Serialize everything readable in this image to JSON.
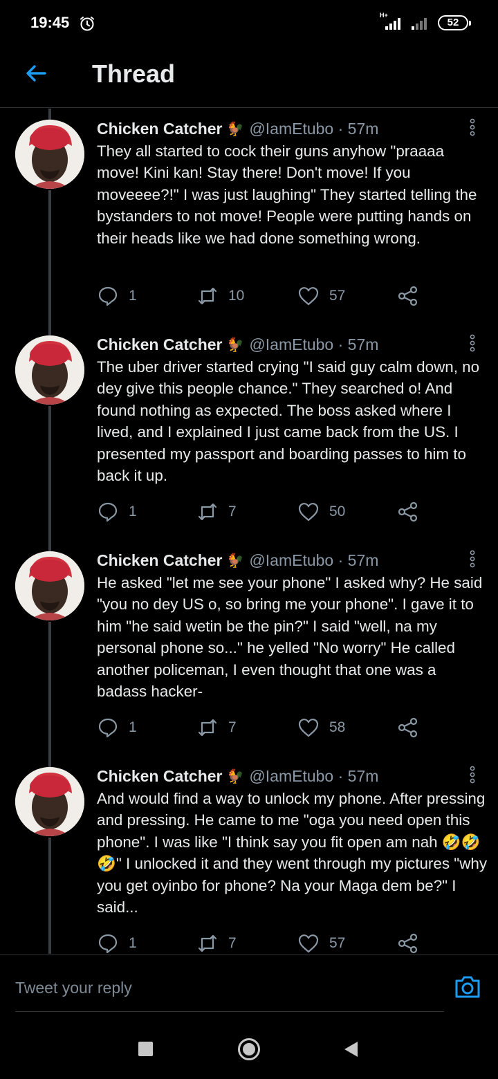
{
  "status_bar": {
    "time": "19:45",
    "network_label": "H+",
    "battery": "52",
    "icons": [
      "alarm-icon",
      "signal-icon",
      "battery-icon"
    ]
  },
  "header": {
    "title": "Thread",
    "back_icon": "arrow-left-icon"
  },
  "tweets": [
    {
      "name": "Chicken Catcher",
      "badge": "🐓",
      "handle": "@IamEtubo",
      "separator": "·",
      "time": "57m",
      "text": "They all started to cock their guns anyhow \"praaaa move! Kini kan! Stay there! Don't move! If you moveeee?!\" I was just laughing\" They started telling the bystanders to not move! People were putting hands on their heads like we had done something wrong.",
      "replies": "1",
      "retweets": "10",
      "likes": "57"
    },
    {
      "name": "Chicken Catcher",
      "badge": "🐓",
      "handle": "@IamEtubo",
      "separator": "·",
      "time": "57m",
      "text": "The uber driver started crying \"I said guy calm down, no dey give this people chance.\" They searched o! And found nothing as expected. The boss asked where I lived, and I explained I just came back from the US. I presented my passport and boarding passes to him to back it up.",
      "replies": "1",
      "retweets": "7",
      "likes": "50"
    },
    {
      "name": "Chicken Catcher",
      "badge": "🐓",
      "handle": "@IamEtubo",
      "separator": "·",
      "time": "57m",
      "text": "He asked \"let me see your phone\" I asked why? He said \"you no dey US o, so bring me your phone\". I gave it to him \"he said wetin be the pin?\" I said \"well, na my personal phone so...\" he yelled \"No worry\" He called another policeman, I even thought that one was a badass hacker-",
      "replies": "1",
      "retweets": "7",
      "likes": "58"
    },
    {
      "name": "Chicken Catcher",
      "badge": "🐓",
      "handle": "@IamEtubo",
      "separator": "·",
      "time": "57m",
      "text": "And would find a way to unlock my phone. After pressing and pressing. He came to me \"oga you need open this phone\". I was like \"I think say you fit open am nah 🤣🤣🤣\" I unlocked it and they went through my pictures \"why you get oyinbo for phone? Na your Maga dem be?\" I said...",
      "replies": "1",
      "retweets": "7",
      "likes": "57"
    }
  ],
  "reply": {
    "placeholder": "Tweet your reply",
    "camera_icon": "camera-icon"
  },
  "nav": {
    "icons": [
      "recents-square-icon",
      "home-circle-icon",
      "back-triangle-icon"
    ]
  },
  "colors": {
    "background": "#000000",
    "accent": "#1d9bf0",
    "secondary_text": "#8b98a5",
    "divider": "#2f3336"
  }
}
